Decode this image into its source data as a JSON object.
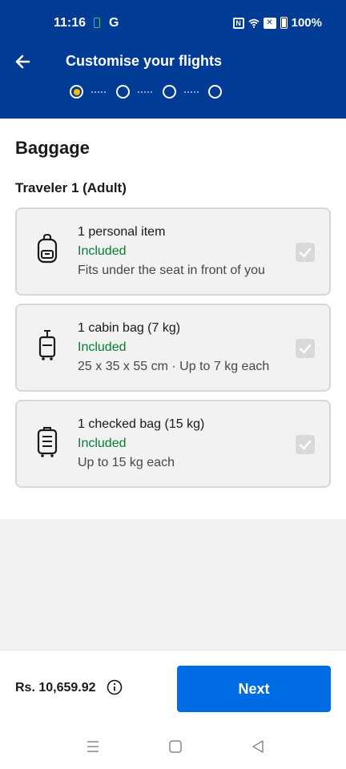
{
  "status_bar": {
    "time": "11:16",
    "carrier_icon": "G",
    "nfc_label": "N",
    "battery": "100%"
  },
  "header": {
    "title": "Customise your flights",
    "back_icon": "arrow-left-icon",
    "steps": [
      {
        "state": "active"
      },
      {
        "state": "inactive"
      },
      {
        "state": "inactive"
      },
      {
        "state": "inactive"
      }
    ],
    "colors": {
      "background": "#003b95",
      "active_step": "#febb02"
    }
  },
  "main": {
    "section_title": "Baggage",
    "traveler_label": "Traveler 1 (Adult)",
    "bags": [
      {
        "icon": "backpack-icon",
        "name": "1 personal item",
        "status": "Included",
        "description": "Fits under the seat in front of you",
        "checked": true
      },
      {
        "icon": "cabin-bag-icon",
        "name": "1 cabin bag (7 kg)",
        "status": "Included",
        "description": "25 x 35 x 55 cm · Up to 7 kg each",
        "checked": true
      },
      {
        "icon": "checked-bag-icon",
        "name": "1 checked bag (15 kg)",
        "status": "Included",
        "description": "Up to 15 kg each",
        "checked": true
      }
    ],
    "colors": {
      "included": "#008234"
    }
  },
  "footer": {
    "price": "Rs. 10,659.92",
    "info_icon": "info-icon",
    "next_label": "Next",
    "colors": {
      "button": "#006ce4"
    }
  },
  "nav_bar": {
    "icons": [
      "menu-icon",
      "home-square-icon",
      "back-triangle-icon"
    ]
  }
}
